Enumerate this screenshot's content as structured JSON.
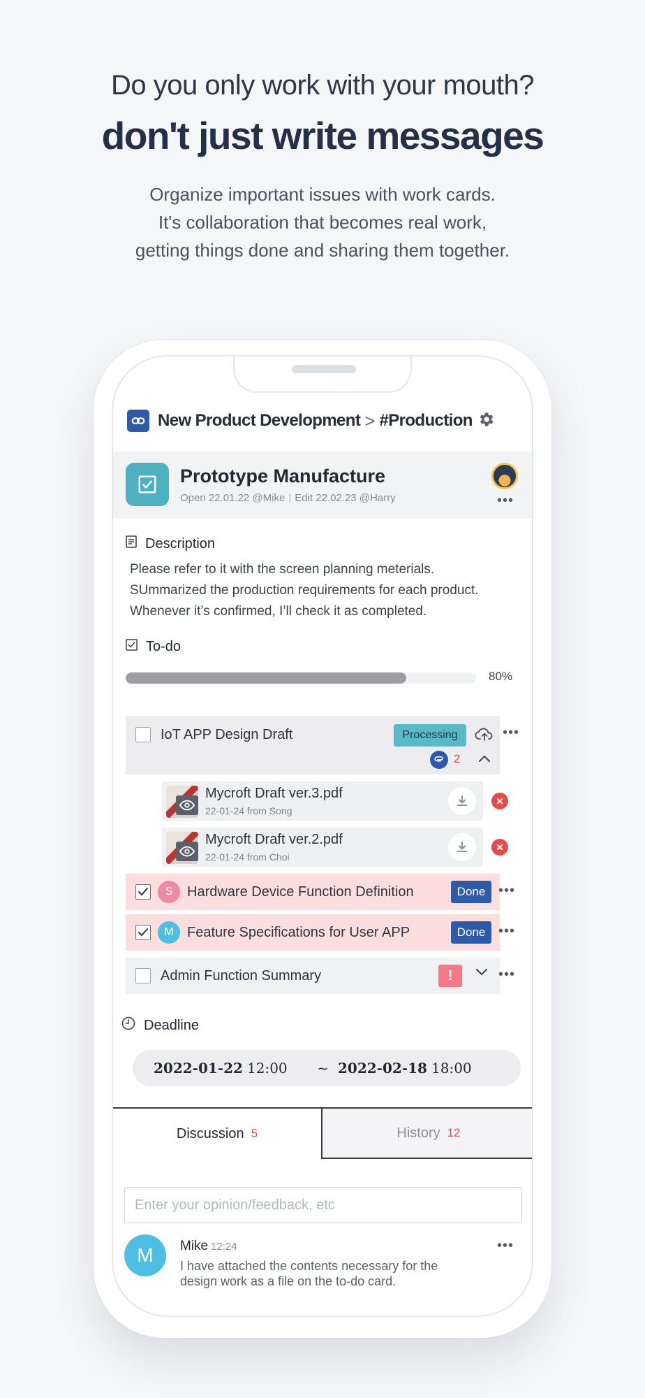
{
  "hero": {
    "line1": "Do you only work with your mouth?",
    "line2": "don't just write messages",
    "sub": [
      "Organize important issues with work cards.",
      "It's collaboration that becomes real work,",
      "getting things done and sharing them together."
    ]
  },
  "breadcrumb": {
    "project": "New Product Development",
    "separator": ">",
    "channel": "#Production"
  },
  "card": {
    "title": "Prototype Manufacture",
    "opened": "Open 22.01.22 @Mike",
    "edited": "Edit 22.02.23 @Harry"
  },
  "description": {
    "heading": "Description",
    "lines": [
      "Please refer to it with the screen planning meterials.",
      "SUmmarized the production requirements for each product.",
      "Whenever it’s confirmed, I’ll check it as completed."
    ]
  },
  "todo": {
    "heading": "To-do",
    "progress_value": 0.8,
    "progress_label": "80%",
    "items": [
      {
        "label": "IoT APP Design Draft",
        "status": "Processing",
        "attachments": "2",
        "checked": false
      },
      {
        "label": "Hardware Device Function Definition",
        "assignee": "S",
        "status": "Done",
        "checked": true
      },
      {
        "label": "Feature Specifications for User APP",
        "assignee": "M",
        "status": "Done",
        "checked": true
      },
      {
        "label": "Admin Function Summary",
        "status": "!",
        "checked": false
      }
    ],
    "files": [
      {
        "name": "Mycroft Draft ver.3.pdf",
        "meta": "22-01-24 from Song"
      },
      {
        "name": "Mycroft Draft ver.2.pdf",
        "meta": "22-01-24 from  Choi"
      }
    ]
  },
  "deadline": {
    "heading": "Deadline",
    "start_date": "2022-01-22",
    "start_time": "12:00",
    "tilde": "~",
    "end_date": "2022-02-18",
    "end_time": "18:00"
  },
  "tabs": {
    "discussion": {
      "label": "Discussion",
      "count": "5"
    },
    "history": {
      "label": "History",
      "count": "12"
    }
  },
  "comment_input": {
    "placeholder": "Enter your opinion/feedback, etc"
  },
  "comment": {
    "avatar": "M",
    "name": "Mike",
    "time": "12:24",
    "lines": [
      "I have attached the contents necessary for the",
      "design work as a file on the to-do card."
    ]
  },
  "colors": {
    "accent_blue": "#2e5aa8",
    "teal": "#4db1c2",
    "done_row": "#fcdede",
    "alert": "#f27a86",
    "count_red": "#e04a4a"
  },
  "icons": [
    "link-icon",
    "gear-icon",
    "checkbox-card-icon",
    "document-icon",
    "checkbox-icon",
    "cloud-upload-icon",
    "paperclip-icon",
    "chevron-up-icon",
    "eye-icon",
    "download-icon",
    "close-icon",
    "chevron-down-icon",
    "clock-icon",
    "more-icon"
  ]
}
